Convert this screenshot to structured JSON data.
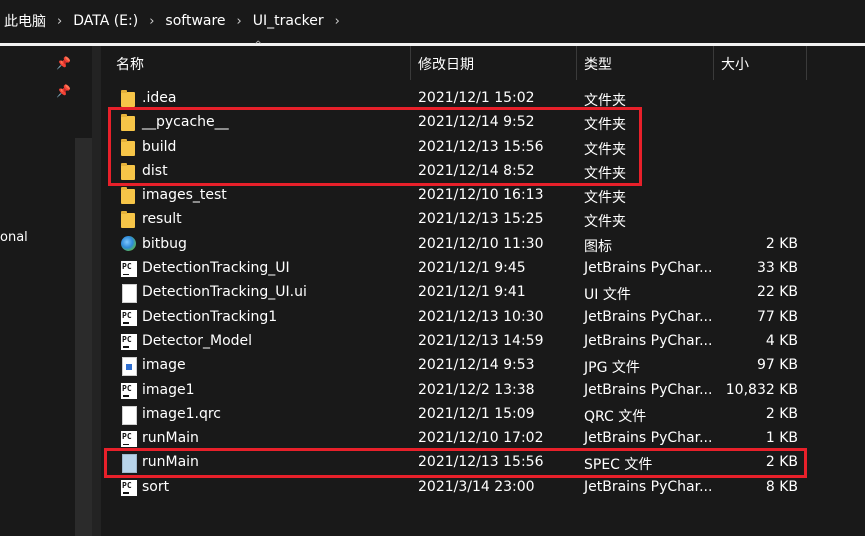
{
  "breadcrumb": [
    "此电脑",
    "DATA (E:)",
    "software",
    "UI_tracker"
  ],
  "breadcrumb_separator": "›",
  "nav": {
    "partial_label": "onal"
  },
  "columns": {
    "name": "名称",
    "date": "修改日期",
    "type": "类型",
    "size": "大小"
  },
  "files": [
    {
      "name": ".idea",
      "date": "2021/12/1 15:02",
      "type": "文件夹",
      "size": "",
      "icon": "folder-icon"
    },
    {
      "name": "__pycache__",
      "date": "2021/12/14 9:52",
      "type": "文件夹",
      "size": "",
      "icon": "folder-icon"
    },
    {
      "name": "build",
      "date": "2021/12/13 15:56",
      "type": "文件夹",
      "size": "",
      "icon": "folder-icon"
    },
    {
      "name": "dist",
      "date": "2021/12/14 8:52",
      "type": "文件夹",
      "size": "",
      "icon": "folder-icon"
    },
    {
      "name": "images_test",
      "date": "2021/12/10 16:13",
      "type": "文件夹",
      "size": "",
      "icon": "folder-icon"
    },
    {
      "name": "result",
      "date": "2021/12/13 15:25",
      "type": "文件夹",
      "size": "",
      "icon": "folder-icon"
    },
    {
      "name": "bitbug",
      "date": "2021/12/10 11:30",
      "type": "图标",
      "size": "2 KB",
      "icon": "ico-file-icon"
    },
    {
      "name": "DetectionTracking_UI",
      "date": "2021/12/1 9:45",
      "type": "JetBrains PyChar...",
      "size": "33 KB",
      "icon": "pycharm-file-icon"
    },
    {
      "name": "DetectionTracking_UI.ui",
      "date": "2021/12/1 9:41",
      "type": "UI 文件",
      "size": "22 KB",
      "icon": "document-icon"
    },
    {
      "name": "DetectionTracking1",
      "date": "2021/12/13 10:30",
      "type": "JetBrains PyChar...",
      "size": "77 KB",
      "icon": "pycharm-file-icon"
    },
    {
      "name": "Detector_Model",
      "date": "2021/12/13 14:59",
      "type": "JetBrains PyChar...",
      "size": "4 KB",
      "icon": "pycharm-file-icon"
    },
    {
      "name": "image",
      "date": "2021/12/14 9:53",
      "type": "JPG 文件",
      "size": "97 KB",
      "icon": "jpg-file-icon"
    },
    {
      "name": "image1",
      "date": "2021/12/2 13:38",
      "type": "JetBrains PyChar...",
      "size": "10,832 KB",
      "icon": "pycharm-file-icon"
    },
    {
      "name": "image1.qrc",
      "date": "2021/12/1 15:09",
      "type": "QRC 文件",
      "size": "2 KB",
      "icon": "document-icon"
    },
    {
      "name": "runMain",
      "date": "2021/12/10 17:02",
      "type": "JetBrains PyChar...",
      "size": "1 KB",
      "icon": "pycharm-file-icon"
    },
    {
      "name": "runMain",
      "date": "2021/12/13 15:56",
      "type": "SPEC 文件",
      "size": "2 KB",
      "icon": "spec-file-icon"
    },
    {
      "name": "sort",
      "date": "2021/3/14 23:00",
      "type": "JetBrains PyChar...",
      "size": "8 KB",
      "icon": "pycharm-file-icon"
    }
  ],
  "highlight_color": "#e8202a",
  "highlighted_rows": [
    [
      1,
      3
    ],
    [
      15,
      15
    ]
  ]
}
